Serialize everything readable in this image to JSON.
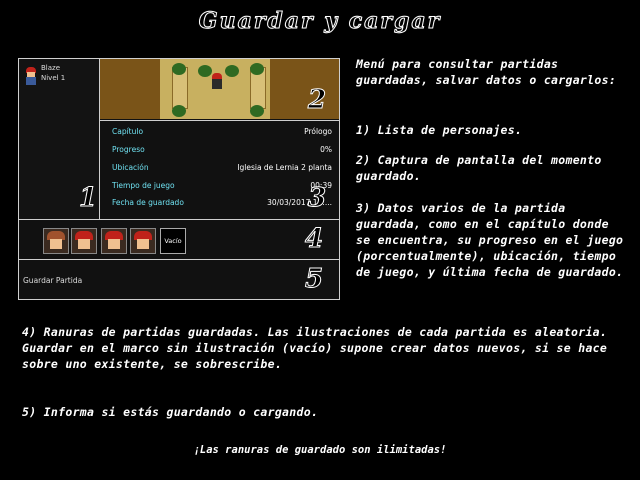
{
  "title": "Guardar y cargar",
  "character": {
    "name": "Blaze",
    "level": "Nivel 1"
  },
  "stats": [
    {
      "label": "Capítulo",
      "value": "Prólogo"
    },
    {
      "label": "Progreso",
      "value": "0%"
    },
    {
      "label": "Ubicación",
      "value": "Iglesia de Lernia 2 planta"
    },
    {
      "label": "Tiempo de juego",
      "value": "00:39"
    },
    {
      "label": "Fecha de guardado",
      "value": "30/03/2017 16:..."
    }
  ],
  "empty_slot_label": "Vacío",
  "mode_label": "Guardar Partida",
  "numbers": [
    "1",
    "2",
    "3",
    "4",
    "5"
  ],
  "description": {
    "intro": "Menú para consultar partidas guardadas, salvar datos o cargarlos:",
    "p1": "1) Lista de personajes.",
    "p2": "2) Captura de pantalla del momento guardado.",
    "p3": "3) Datos varios de la partida guardada, como en el capítulo donde se encuentra, su progreso en el juego (porcentualmente), ubicación, tiempo de juego, y última fecha de guardado.",
    "p4": "4) Ranuras de partidas guardadas. Las ilustraciones de cada partida es aleatoria. Guardar en el marco sin ilustración (vacío) supone crear datos nuevos, si se hace sobre uno existente, se sobrescribe.",
    "p5": "5) Informa si estás guardando o cargando."
  },
  "footer": "¡Las ranuras de guardado son ilimitadas!",
  "colors": {
    "stat_label": "#6fe0f0",
    "background": "#000000",
    "border": "#cfcfcf"
  }
}
